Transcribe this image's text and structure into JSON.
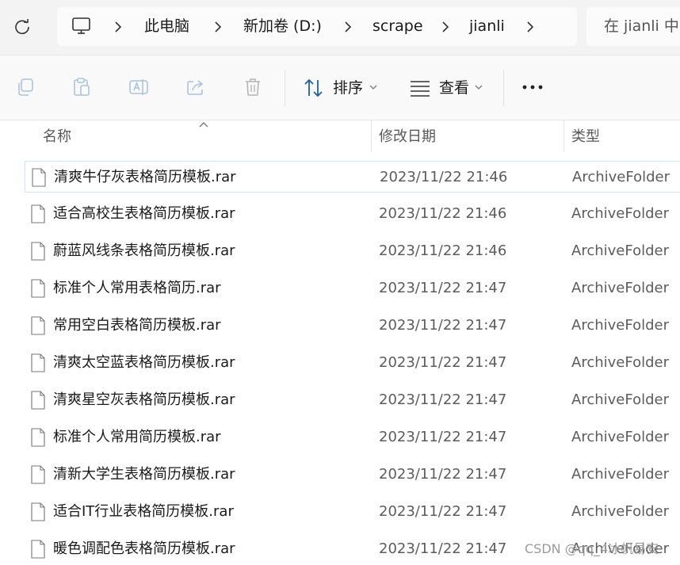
{
  "address_bar": {
    "crumbs": [
      "此电脑",
      "新加卷 (D:)",
      "scrape",
      "jianli"
    ],
    "search_placeholder": "在 jianli 中"
  },
  "toolbar": {
    "sort_label": "排序",
    "view_label": "查看",
    "icons": [
      "copy-icon",
      "paste-icon",
      "rename-icon",
      "share-icon",
      "delete-icon",
      "sort-icon",
      "view-icon",
      "more-icon"
    ]
  },
  "columns": {
    "name": "名称",
    "date": "修改日期",
    "type": "类型"
  },
  "files": [
    {
      "name": "清爽牛仔灰表格简历模板.rar",
      "date": "2023/11/22 21:46",
      "type": "ArchiveFolder"
    },
    {
      "name": "适合高校生表格简历模板.rar",
      "date": "2023/11/22 21:46",
      "type": "ArchiveFolder"
    },
    {
      "name": "蔚蓝风线条表格简历模板.rar",
      "date": "2023/11/22 21:46",
      "type": "ArchiveFolder"
    },
    {
      "name": "标准个人常用表格简历.rar",
      "date": "2023/11/22 21:47",
      "type": "ArchiveFolder"
    },
    {
      "name": "常用空白表格简历模板.rar",
      "date": "2023/11/22 21:47",
      "type": "ArchiveFolder"
    },
    {
      "name": "清爽太空蓝表格简历模板.rar",
      "date": "2023/11/22 21:47",
      "type": "ArchiveFolder"
    },
    {
      "name": "清爽星空灰表格简历模板.rar",
      "date": "2023/11/22 21:47",
      "type": "ArchiveFolder"
    },
    {
      "name": "标准个人常用简历模板.rar",
      "date": "2023/11/22 21:47",
      "type": "ArchiveFolder"
    },
    {
      "name": "清新大学生表格简历模板.rar",
      "date": "2023/11/22 21:47",
      "type": "ArchiveFolder"
    },
    {
      "name": "适合IT行业表格简历模板.rar",
      "date": "2023/11/22 21:47",
      "type": "ArchiveFolder"
    },
    {
      "name": "暖色调配色表格简历模板.rar",
      "date": "2023/11/22 21:47",
      "type": "ArchiveFolder"
    }
  ],
  "watermark": "CSDN @qq_4冰帆易安"
}
